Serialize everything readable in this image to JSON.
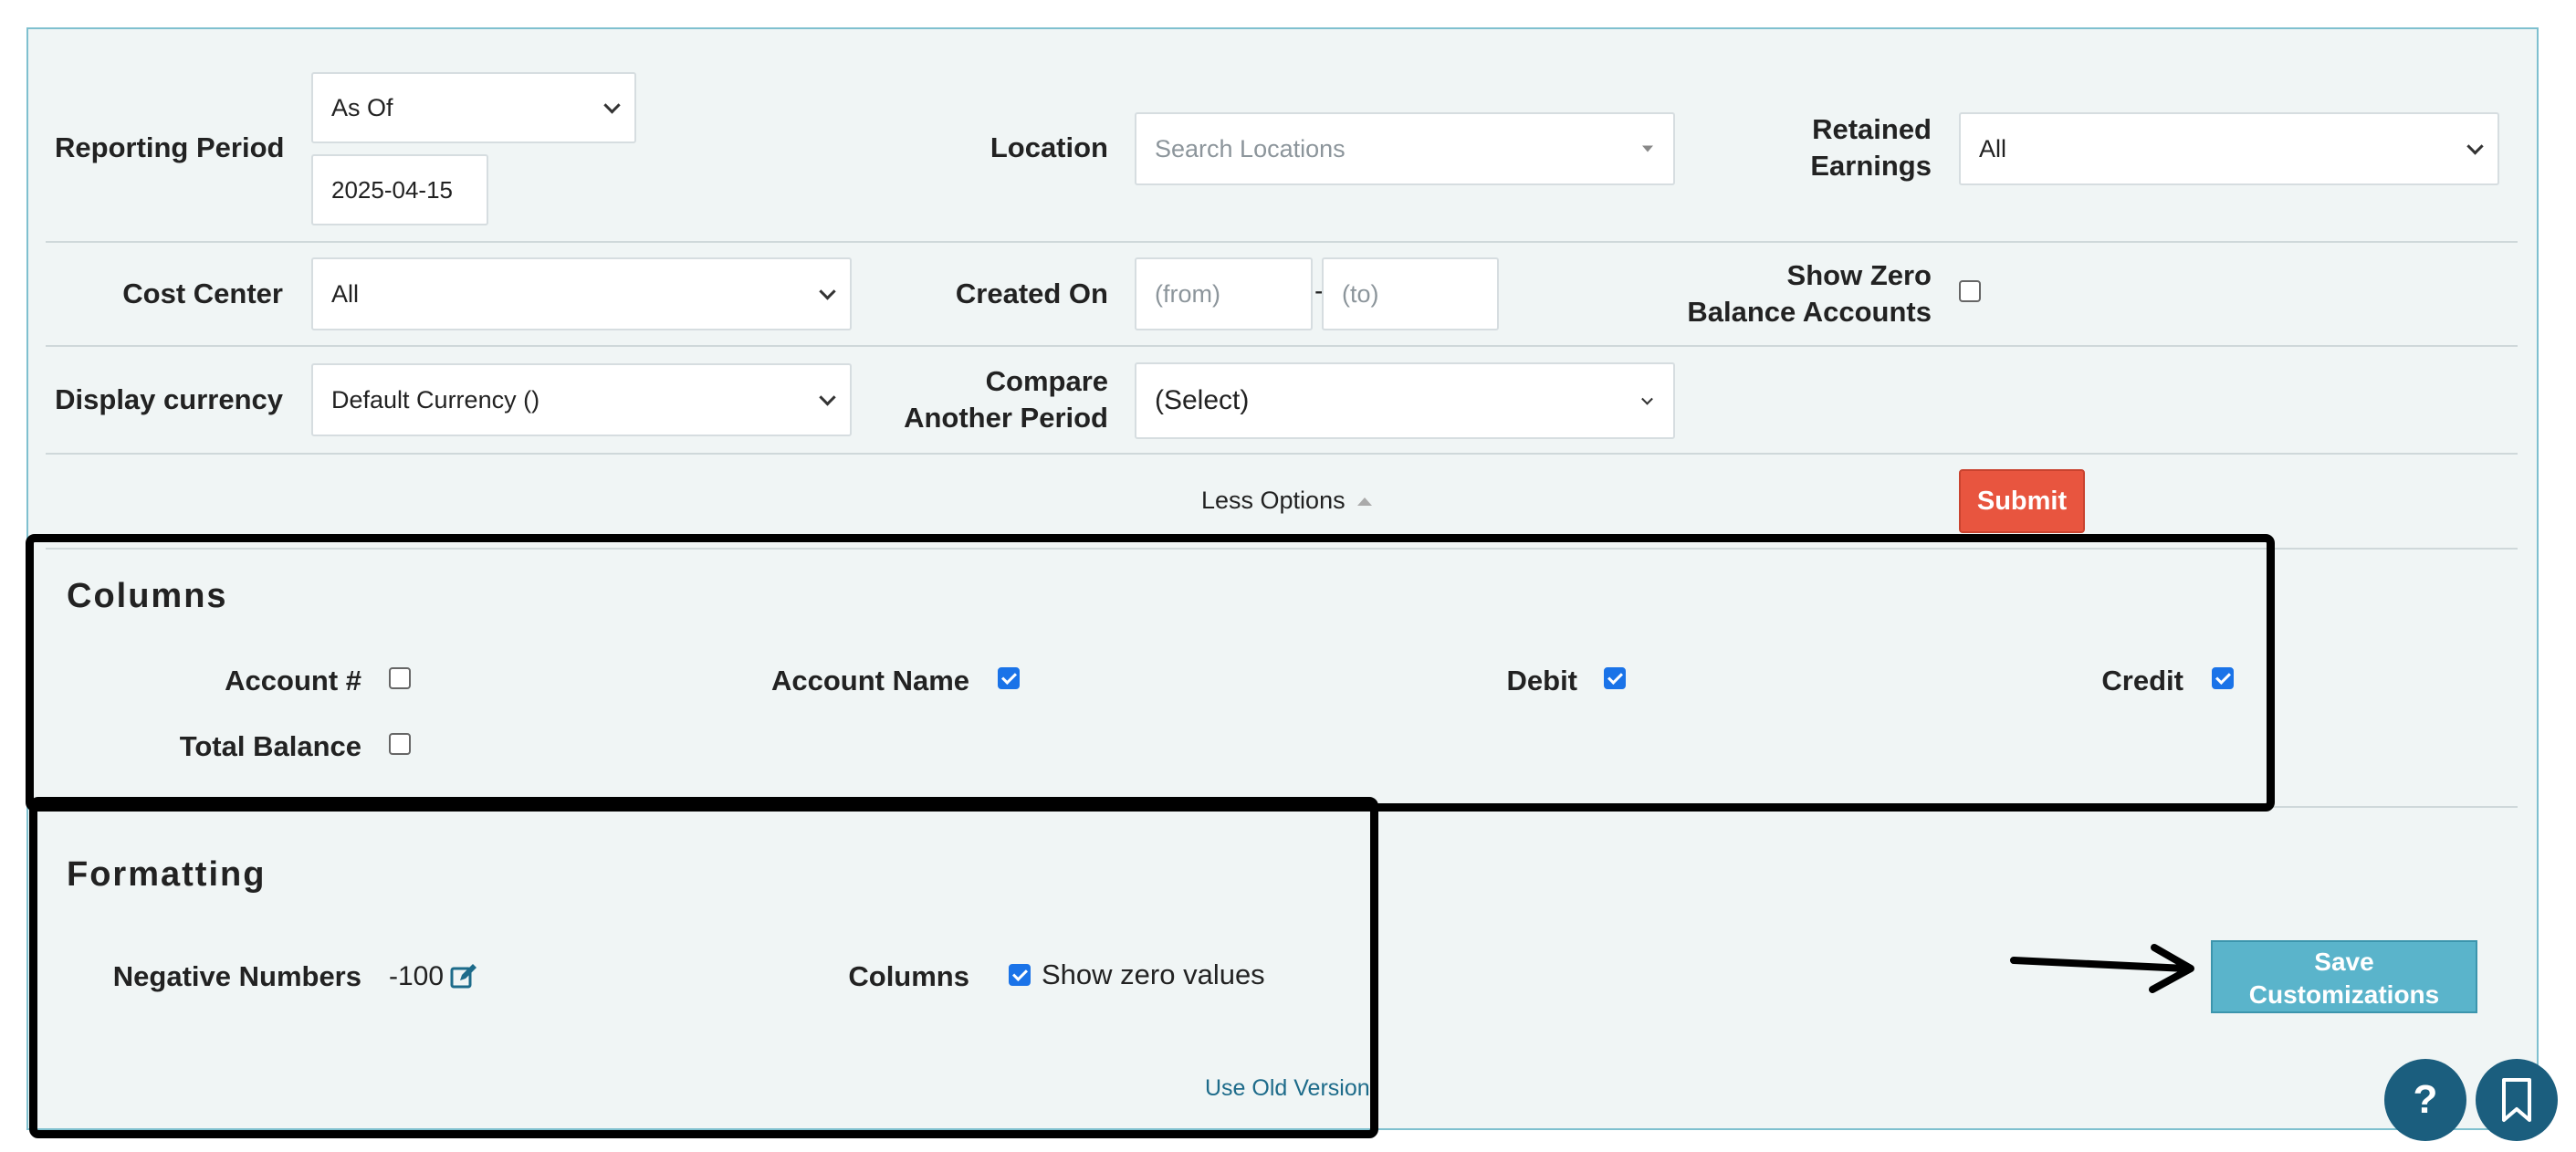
{
  "filters": {
    "reporting_period": {
      "label": "Reporting Period",
      "mode": "As Of",
      "date": "2025-04-15"
    },
    "location": {
      "label": "Location",
      "placeholder": "Search Locations"
    },
    "retained_earnings": {
      "label_line1": "Retained",
      "label_line2": "Earnings",
      "value": "All"
    },
    "cost_center": {
      "label": "Cost Center",
      "value": "All"
    },
    "created_on": {
      "label": "Created On",
      "from_placeholder": "(from)",
      "separator": "-",
      "to_placeholder": "(to)"
    },
    "show_zero_balance": {
      "label_line1": "Show Zero",
      "label_line2": "Balance Accounts",
      "checked": false
    },
    "display_currency": {
      "label": "Display currency",
      "value": "Default Currency ()"
    },
    "compare_period": {
      "label_line1": "Compare",
      "label_line2": "Another Period",
      "value": "(Select)"
    }
  },
  "options_toggle": {
    "label": "Less Options"
  },
  "submit_label": "Submit",
  "columns_section": {
    "title": "Columns",
    "items": [
      {
        "label": "Account #",
        "checked": false
      },
      {
        "label": "Account Name",
        "checked": true
      },
      {
        "label": "Debit",
        "checked": true
      },
      {
        "label": "Credit",
        "checked": true
      },
      {
        "label": "Total Balance",
        "checked": false
      }
    ]
  },
  "formatting_section": {
    "title": "Formatting",
    "negative_numbers_label": "Negative Numbers",
    "negative_numbers_value": "-100",
    "columns_label": "Columns",
    "show_zero_values_label": "Show zero values",
    "show_zero_values_checked": true,
    "old_version_link": "Use Old Version"
  },
  "save_customizations": {
    "line1": "Save",
    "line2": "Customizations"
  },
  "help_button": {
    "glyph": "?"
  },
  "colors": {
    "submit": "#e8553f",
    "save": "#5ab4cb",
    "accent": "#1b5e7e",
    "checkbox": "#1a73e8"
  }
}
